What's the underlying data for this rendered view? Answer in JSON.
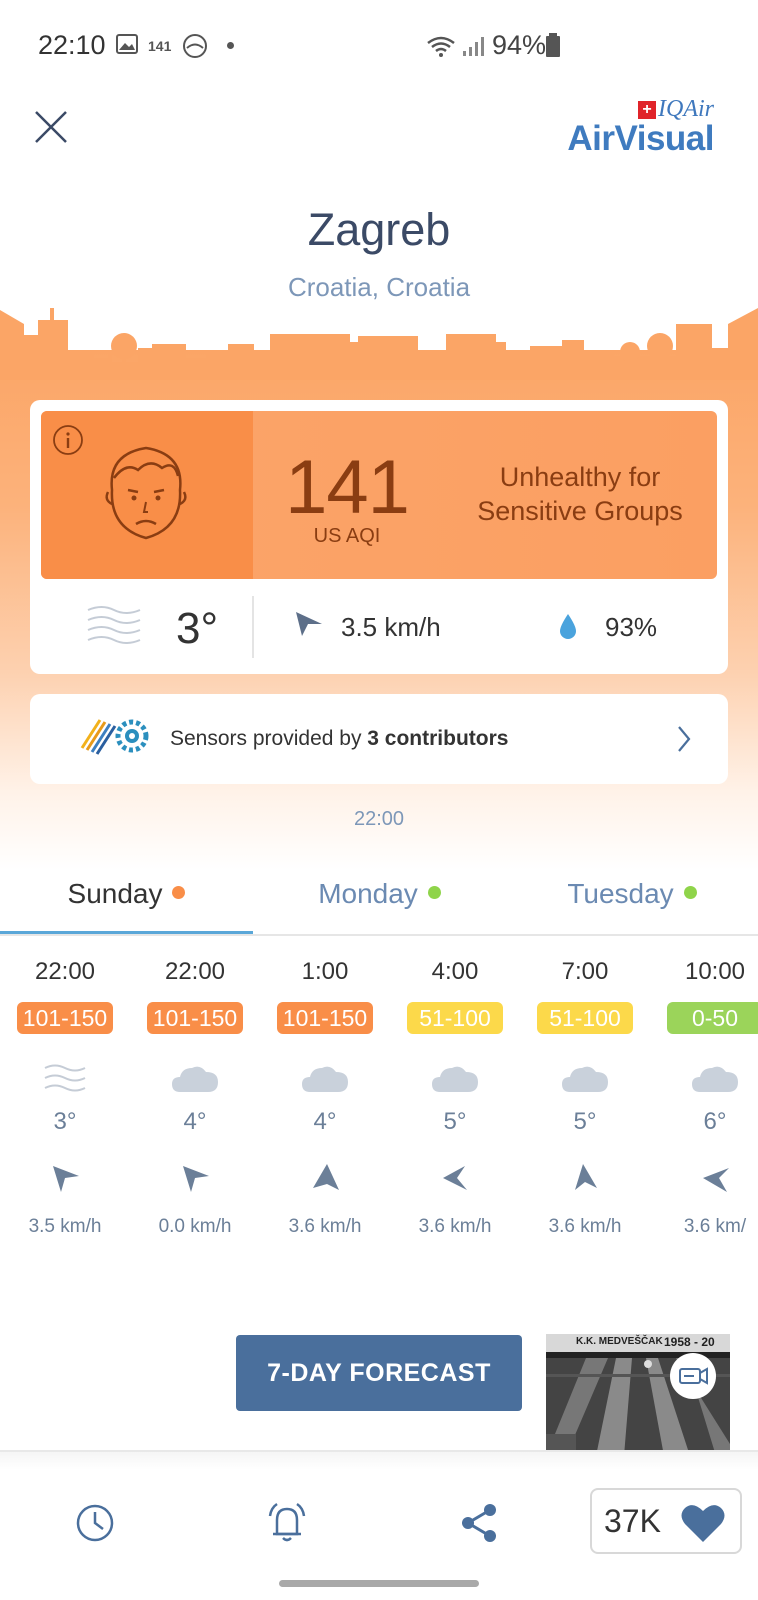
{
  "status_bar": {
    "time": "22:10",
    "aqi_badge": "141",
    "battery": "94%"
  },
  "brand": {
    "top": "IQAir",
    "main": "AirVisual"
  },
  "location": {
    "city": "Zagreb",
    "country": "Croatia, Croatia"
  },
  "aqi": {
    "value": "141",
    "unit": "US AQI",
    "status_line1": "Unhealthy for",
    "status_line2": "Sensitive Groups"
  },
  "weather": {
    "temperature": "3°",
    "wind": "3.5 km/h",
    "humidity": "93%"
  },
  "contributors": {
    "prefix": "Sensors provided by ",
    "count": "3 contributors"
  },
  "updated_time": "22:00",
  "tabs": [
    {
      "label": "Sunday",
      "dot_color": "#f98e48",
      "active": true
    },
    {
      "label": "Monday",
      "dot_color": "#8fd44a",
      "active": false
    },
    {
      "label": "Tuesday",
      "dot_color": "#8fd44a",
      "active": false
    }
  ],
  "hourly": [
    {
      "time": "22:00",
      "aqi": "101-150",
      "aqi_color": "#f98e48",
      "icon": "wind-lines-icon",
      "temp": "3°",
      "wind": "3.5 km/h"
    },
    {
      "time": "22:00",
      "aqi": "101-150",
      "aqi_color": "#f98e48",
      "icon": "cloud-icon",
      "temp": "4°",
      "wind": "0.0 km/h"
    },
    {
      "time": "1:00",
      "aqi": "101-150",
      "aqi_color": "#f98e48",
      "icon": "cloud-icon",
      "temp": "4°",
      "wind": "3.6 km/h"
    },
    {
      "time": "4:00",
      "aqi": "51-100",
      "aqi_color": "#fcd94a",
      "icon": "cloud-icon",
      "temp": "5°",
      "wind": "3.6 km/h"
    },
    {
      "time": "7:00",
      "aqi": "51-100",
      "aqi_color": "#fcd94a",
      "icon": "cloud-icon",
      "temp": "5°",
      "wind": "3.6 km/h"
    },
    {
      "time": "10:00",
      "aqi": "0-50",
      "aqi_color": "#9bd45a",
      "icon": "cloud-icon",
      "temp": "6°",
      "wind": "3.6 km/"
    }
  ],
  "forecast_button": "7-DAY FORECAST",
  "camera": {
    "banner": "K.K. MEDVEŠČAK",
    "years": "1958 - 20"
  },
  "likes": "37K",
  "colors": {
    "accent_blue": "#4a6f9c",
    "aqi_orange": "#f98e48",
    "brand_blue": "#3f7bbf"
  }
}
